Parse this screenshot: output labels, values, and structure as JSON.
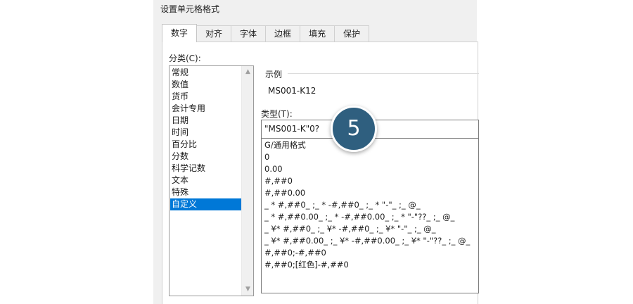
{
  "dialog": {
    "title": "设置单元格格式"
  },
  "tabs": [
    {
      "label": "数字",
      "active": true
    },
    {
      "label": "对齐",
      "active": false
    },
    {
      "label": "字体",
      "active": false
    },
    {
      "label": "边框",
      "active": false
    },
    {
      "label": "填充",
      "active": false
    },
    {
      "label": "保护",
      "active": false
    }
  ],
  "category": {
    "label": "分类(C):",
    "items": [
      "常规",
      "数值",
      "货币",
      "会计专用",
      "日期",
      "时间",
      "百分比",
      "分数",
      "科学记数",
      "文本",
      "特殊",
      "自定义"
    ],
    "selected": "自定义"
  },
  "sample": {
    "label": "示例",
    "value": "MS001-K12"
  },
  "type": {
    "label": "类型(T):",
    "value": "\"MS001-K\"0?",
    "formats": [
      "G/通用格式",
      "0",
      "0.00",
      "#,##0",
      "#,##0.00",
      "_ * #,##0_ ;_ * -#,##0_ ;_ * \"-\"_ ;_ @_",
      "_ * #,##0.00_ ;_ * -#,##0.00_ ;_ * \"-\"??_ ;_ @_",
      "_ ¥* #,##0_ ;_ ¥* -#,##0_ ;_ ¥* \"-\"_ ;_ @_",
      "_ ¥* #,##0.00_ ;_ ¥* -#,##0.00_ ;_ ¥* \"-\"??_ ;_ @_",
      "#,##0;-#,##0",
      "#,##0;[红色]-#,##0"
    ]
  },
  "badge": {
    "number": "5"
  },
  "colors": {
    "selection": "#0078d7",
    "badge": "#2f5f7f"
  },
  "icons": {
    "scroll_up": "chevron-up-icon",
    "scroll_down": "chevron-down-icon"
  }
}
